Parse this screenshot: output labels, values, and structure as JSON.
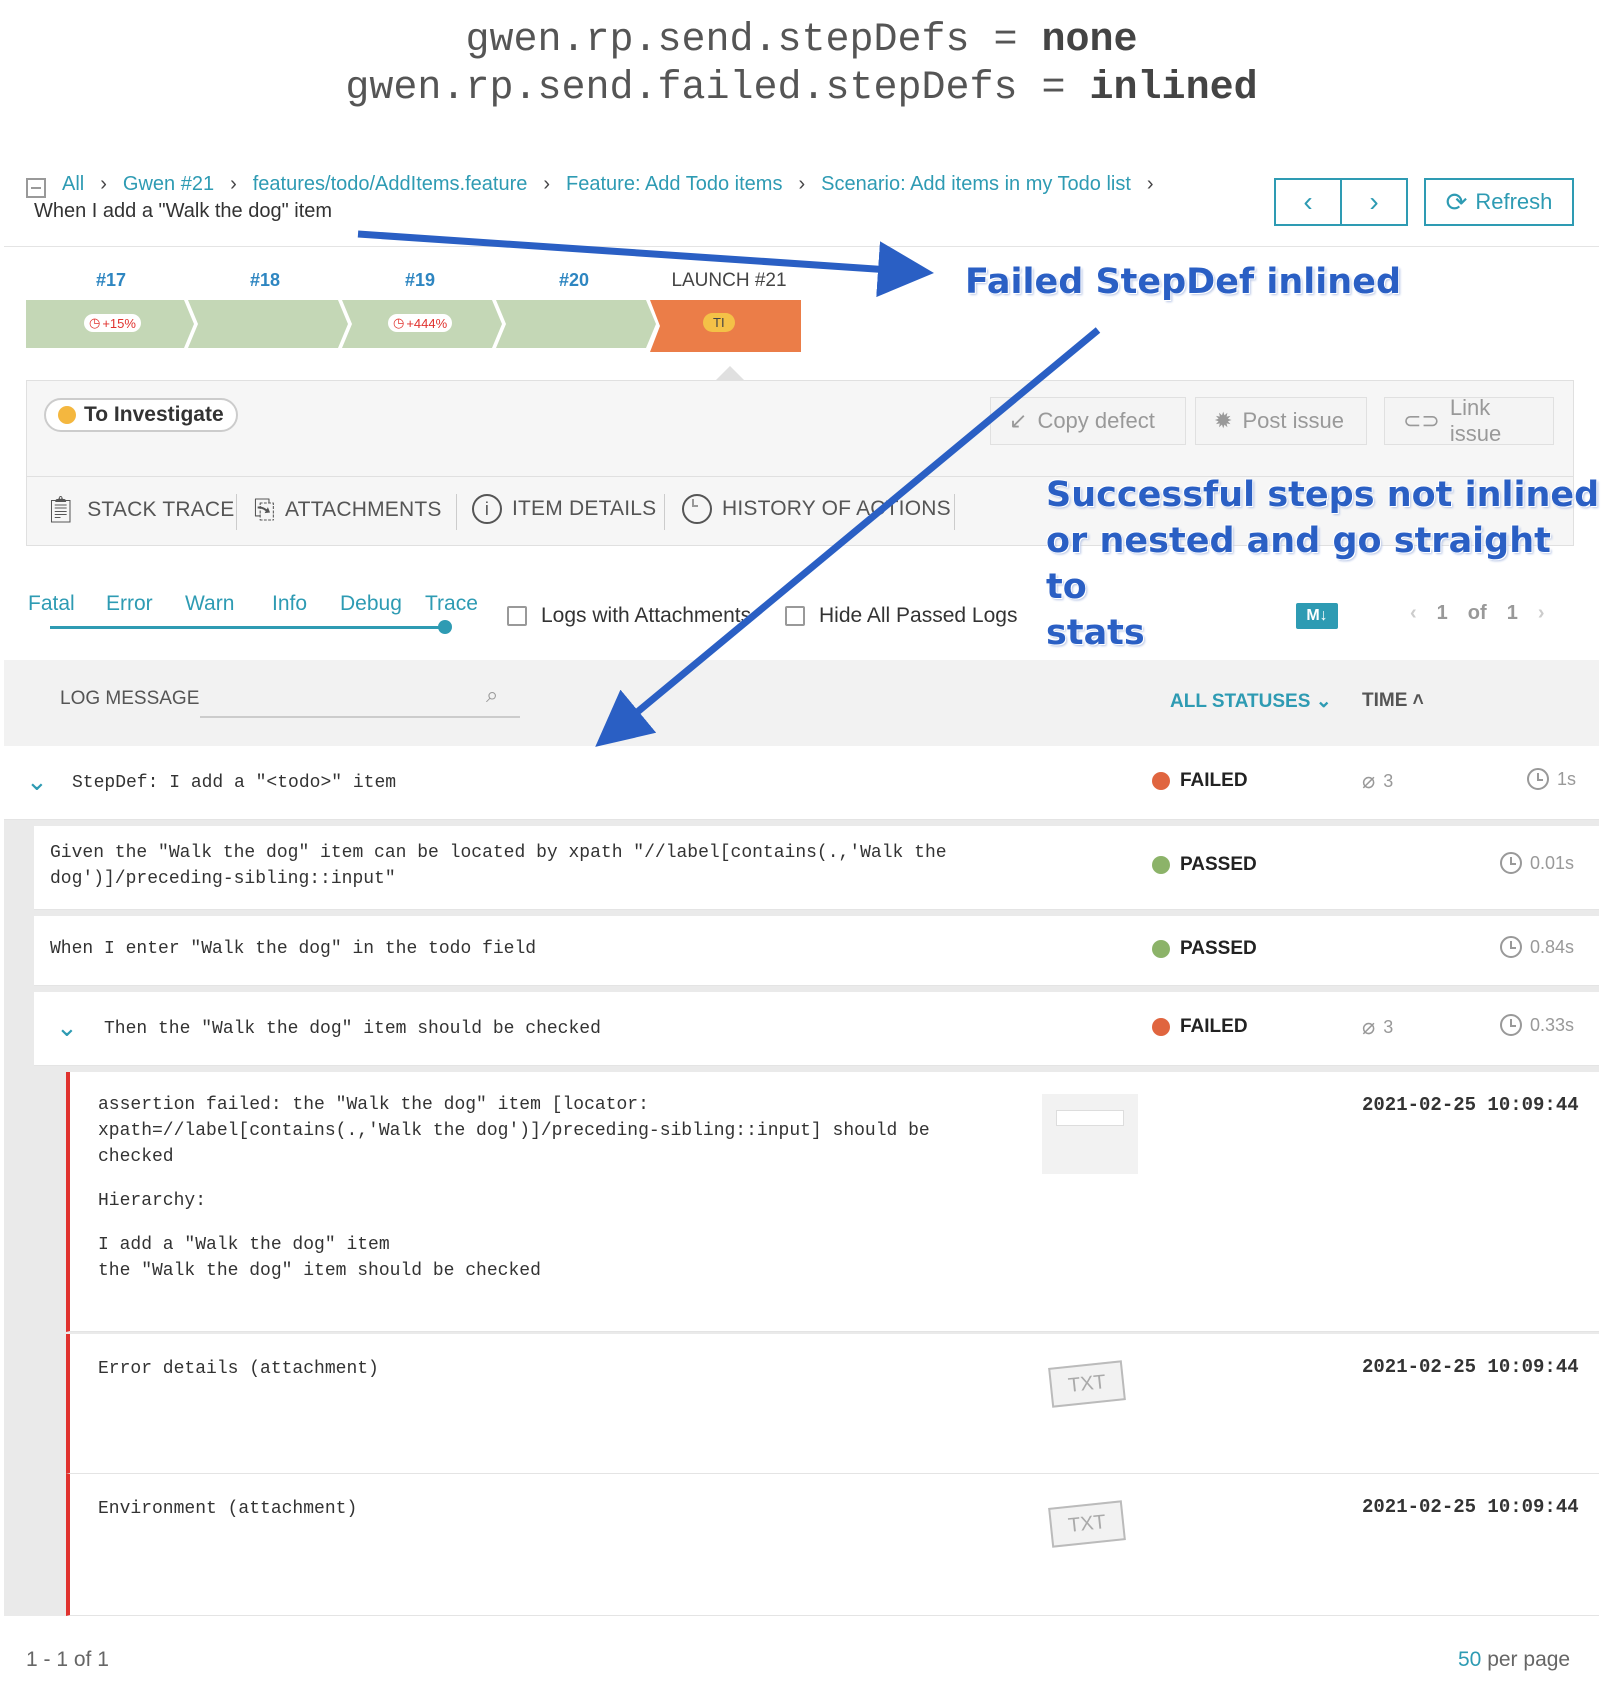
{
  "header": {
    "line1_key": "gwen.rp.send.stepDefs = ",
    "line1_val": "none",
    "line2_key": "gwen.rp.send.failed.stepDefs = ",
    "line2_val": "inlined"
  },
  "breadcrumb": {
    "items": [
      "All",
      "Gwen #21",
      "features/todo/AddItems.feature",
      "Feature: Add Todo items",
      "Scenario: Add items in my Todo list"
    ],
    "current": "When I add a \"Walk the dog\" item"
  },
  "nav": {
    "prev_icon": "chevron-left-icon",
    "next_icon": "chevron-right-icon",
    "refresh_label": "Refresh"
  },
  "history": {
    "items": [
      {
        "label": "#17",
        "badge": "+15%",
        "color": "#c4d7b6"
      },
      {
        "label": "#18",
        "badge": "",
        "color": "#c4d7b6"
      },
      {
        "label": "#19",
        "badge": "+444%",
        "color": "#c4d7b6"
      },
      {
        "label": "#20",
        "badge": "",
        "color": "#c4d7b6"
      },
      {
        "label": "LAUNCH #21",
        "badge": "TI",
        "color": "#eb7d48"
      }
    ]
  },
  "defect": {
    "status": "To Investigate",
    "status_color": "#f4b73f",
    "copy_label": "Copy defect",
    "post_label": "Post issue",
    "link_label": "Link issue"
  },
  "tabs": [
    "STACK TRACE",
    "ATTACHMENTS",
    "ITEM DETAILS",
    "HISTORY OF ACTIONS"
  ],
  "filters": {
    "levels": [
      "Fatal",
      "Error",
      "Warn",
      "Info",
      "Debug",
      "Trace"
    ],
    "logs_with_attachments": "Logs with Attachments",
    "hide_passed": "Hide All Passed Logs",
    "md_badge": "M↓",
    "page_current": "1",
    "page_of": "of",
    "page_total": "1"
  },
  "table": {
    "log_message_header": "LOG MESSAGE",
    "statuses_header": "ALL STATUSES",
    "time_header": "TIME"
  },
  "rows": {
    "stepdef": {
      "text": "StepDef: I add a \"<todo>\" item",
      "status": "FAILED",
      "attachments": "3",
      "time": "1s"
    },
    "step1": {
      "text": "Given the \"Walk the dog\" item can be located by xpath \"//label[contains(.,'Walk the dog')]/preceding-sibling::input\"",
      "status": "PASSED",
      "time": "0.01s"
    },
    "step2": {
      "text": "When I enter \"Walk the dog\" in the todo field",
      "status": "PASSED",
      "time": "0.84s"
    },
    "step3": {
      "text": "Then the \"Walk the dog\" item should be checked",
      "status": "FAILED",
      "attachments": "3",
      "time": "0.33s"
    }
  },
  "logs": [
    {
      "lines": [
        "assertion failed: the \"Walk the dog\" item [locator:",
        "xpath=//label[contains(.,'Walk the dog')]/preceding-sibling::input] should be",
        "checked",
        "",
        "Hierarchy:",
        "",
        "I add a \"Walk the dog\" item",
        "the \"Walk the dog\" item should be checked"
      ],
      "timestamp": "2021-02-25 10:09:44"
    },
    {
      "lines": [
        "Error details (attachment)"
      ],
      "timestamp": "2021-02-25 10:09:44",
      "attachment": "TXT"
    },
    {
      "lines": [
        "Environment (attachment)"
      ],
      "timestamp": "2021-02-25 10:09:44",
      "attachment": "TXT"
    }
  ],
  "footer": {
    "range": "1 - 1 of 1",
    "per_page_count": "50",
    "per_page_label": "per page"
  },
  "annotations": {
    "failed_inlined": "Failed StepDef inlined",
    "successful": [
      "Successful steps not inlined",
      "or nested and go straight to",
      "stats"
    ]
  },
  "colors": {
    "accent": "#2e9bb3",
    "failed": "#e0653f",
    "passed": "#8cb369",
    "annotation": "#2a5fc4"
  }
}
